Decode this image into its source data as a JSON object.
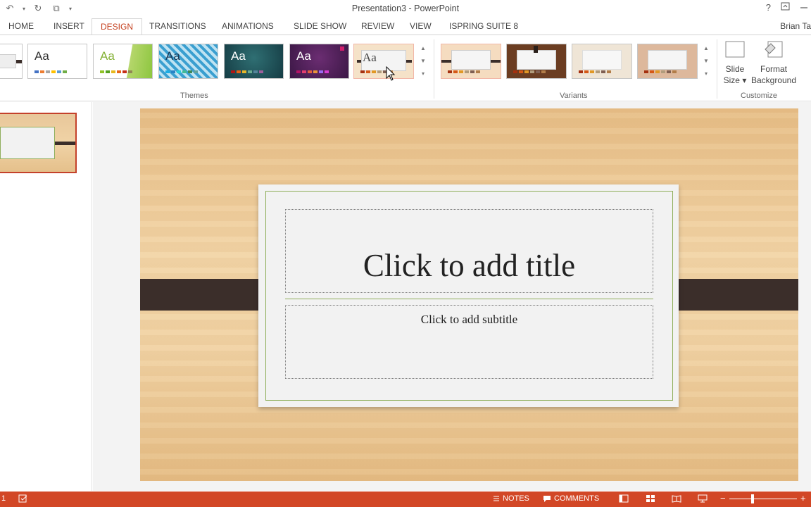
{
  "window": {
    "title": "Presentation3 - PowerPoint",
    "help": "?",
    "user": "Brian Ta"
  },
  "qat": {
    "undo": "↶",
    "undo_arrow": "▾",
    "redo": "↻",
    "present": "⧉",
    "customize": "▾"
  },
  "tabs": [
    "HOME",
    "INSERT",
    "DESIGN",
    "TRANSITIONS",
    "ANIMATIONS",
    "SLIDE SHOW",
    "REVIEW",
    "VIEW",
    "ISPRING SUITE 8"
  ],
  "active_tab": "DESIGN",
  "ribbon": {
    "themes_label": "Themes",
    "variants_label": "Variants",
    "customize_label": "Customize",
    "theme_sample": "Aa",
    "slide_size": [
      "Slide",
      "Size ▾"
    ],
    "format_background": [
      "Format",
      "Background"
    ]
  },
  "slide": {
    "title_placeholder": "Click to add title",
    "subtitle_placeholder": "Click to add subtitle"
  },
  "status": {
    "slide_number": "1",
    "notes": "NOTES",
    "comments": "COMMENTS",
    "zoom_minus": "−",
    "zoom_plus": "+"
  },
  "colors": {
    "accent": "#c43e1c",
    "statusbar": "#d24726",
    "card_border": "#8fae5b",
    "strap": "#3b2e2a"
  }
}
